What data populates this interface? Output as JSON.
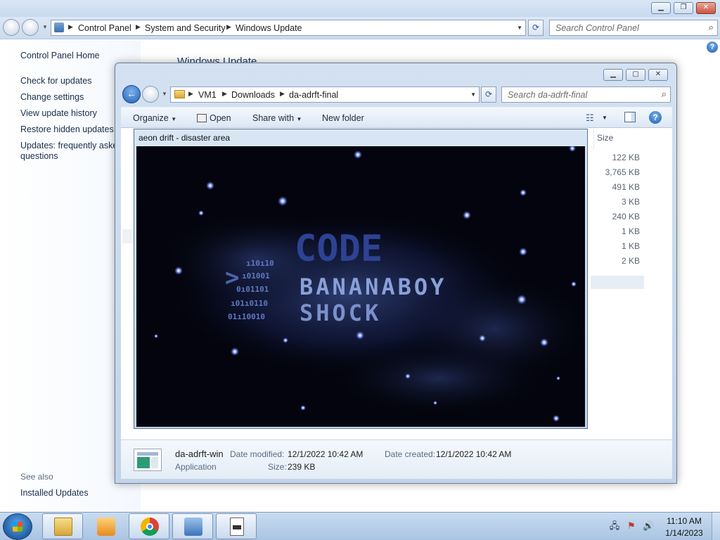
{
  "control_panel": {
    "breadcrumb": [
      "Control Panel",
      "System and Security",
      "Windows Update"
    ],
    "search_placeholder": "Search Control Panel",
    "heading": "Windows Update",
    "sidebar": {
      "home": "Control Panel Home",
      "links": [
        "Check for updates",
        "Change settings",
        "View update history",
        "Restore hidden updates",
        "Updates: frequently asked",
        "questions"
      ],
      "see_also": "See also",
      "installed_updates": "Installed Updates"
    }
  },
  "explorer": {
    "breadcrumb": [
      "VM1",
      "Downloads",
      "da-adrft-final"
    ],
    "search_placeholder": "Search da-adrft-final",
    "toolbar": {
      "organize": "Organize",
      "open": "Open",
      "share_with": "Share with",
      "new_folder": "New folder"
    },
    "size_column_header": "Size",
    "sizes": [
      "122 KB",
      "3,765 KB",
      "491 KB",
      "3 KB",
      "240 KB",
      "1 KB",
      "1 KB",
      "2 KB"
    ],
    "selected_index": 4,
    "details": {
      "name": "da-adrft-win",
      "type": "Application",
      "date_modified_label": "Date modified:",
      "date_modified": "12/1/2022 10:42 AM",
      "date_created_label": "Date created:",
      "date_created": "12/1/2022 10:42 AM",
      "size_label": "Size:",
      "size": "239 KB"
    }
  },
  "game_window": {
    "title": "aeon drift - disaster area",
    "logo_line1": "CODE",
    "logo_line2": "BANANABOY",
    "logo_line3": "SHOCK",
    "binary": [
      "ı10ı10",
      "ı01001",
      "0ı01101",
      "ı01ı0110",
      "01ı10010"
    ]
  },
  "taskbar": {
    "time": "11:10 AM",
    "date": "1/14/2023"
  }
}
